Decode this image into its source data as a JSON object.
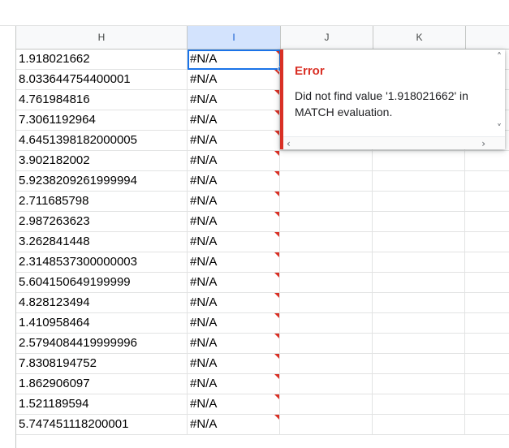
{
  "columns": [
    "H",
    "I",
    "J",
    "K"
  ],
  "rows": [
    {
      "h": "1.918021662",
      "i": "#N/A"
    },
    {
      "h": "8.033644754400001",
      "i": "#N/A"
    },
    {
      "h": "4.761984816",
      "i": "#N/A"
    },
    {
      "h": "7.3061192964",
      "i": "#N/A"
    },
    {
      "h": "4.6451398182000005",
      "i": "#N/A"
    },
    {
      "h": "3.902182002",
      "i": "#N/A"
    },
    {
      "h": "5.9238209261999994",
      "i": "#N/A"
    },
    {
      "h": "2.711685798",
      "i": "#N/A"
    },
    {
      "h": "2.987263623",
      "i": "#N/A"
    },
    {
      "h": "3.262841448",
      "i": "#N/A"
    },
    {
      "h": "2.3148537300000003",
      "i": "#N/A"
    },
    {
      "h": "5.604150649199999",
      "i": "#N/A"
    },
    {
      "h": "4.828123494",
      "i": "#N/A"
    },
    {
      "h": "1.410958464",
      "i": "#N/A"
    },
    {
      "h": "2.5794084419999996",
      "i": "#N/A"
    },
    {
      "h": "7.8308194752",
      "i": "#N/A"
    },
    {
      "h": "1.862906097",
      "i": "#N/A"
    },
    {
      "h": "1.521189594",
      "i": "#N/A"
    },
    {
      "h": "5.747451118200001",
      "i": "#N/A"
    }
  ],
  "error_popup": {
    "title": "Error",
    "message": "Did not find value '1.918021662' in MATCH evaluation."
  },
  "colors": {
    "error_red": "#d93025",
    "selection_blue": "#1a73e8"
  }
}
